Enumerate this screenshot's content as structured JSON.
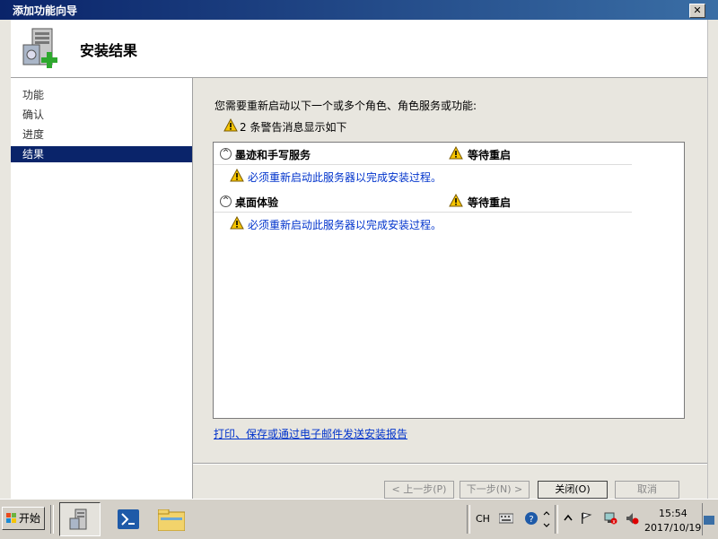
{
  "window": {
    "title": "添加功能向导",
    "close_label": "✕",
    "heading": "安装结果"
  },
  "nav": {
    "items": [
      {
        "label": "功能",
        "active": false
      },
      {
        "label": "确认",
        "active": false
      },
      {
        "label": "进度",
        "active": false
      },
      {
        "label": "结果",
        "active": true
      }
    ]
  },
  "content": {
    "intro": "您需要重新启动以下一个或多个角色、角色服务或功能:",
    "warning_summary": "2 条警告消息显示如下",
    "results": [
      {
        "name": "墨迹和手写服务",
        "status": "等待重启",
        "message": "必须重新启动此服务器以完成安装过程。"
      },
      {
        "name": "桌面体验",
        "status": "等待重启",
        "message": "必须重新启动此服务器以完成安装过程。"
      }
    ],
    "report_link": "打印、保存或通过电子邮件发送安装报告"
  },
  "buttons": {
    "prev": "< 上一步(P)",
    "next": "下一步(N) >",
    "close": "关闭(O)",
    "cancel": "取消"
  },
  "taskbar": {
    "start_label": "开始",
    "lang": "CH",
    "time": "15:54",
    "date": "2017/10/19"
  },
  "colors": {
    "title_bar": "#0a246a",
    "nav_active": "#0a246a",
    "link": "#0033cc",
    "warning": "#f5c400"
  }
}
